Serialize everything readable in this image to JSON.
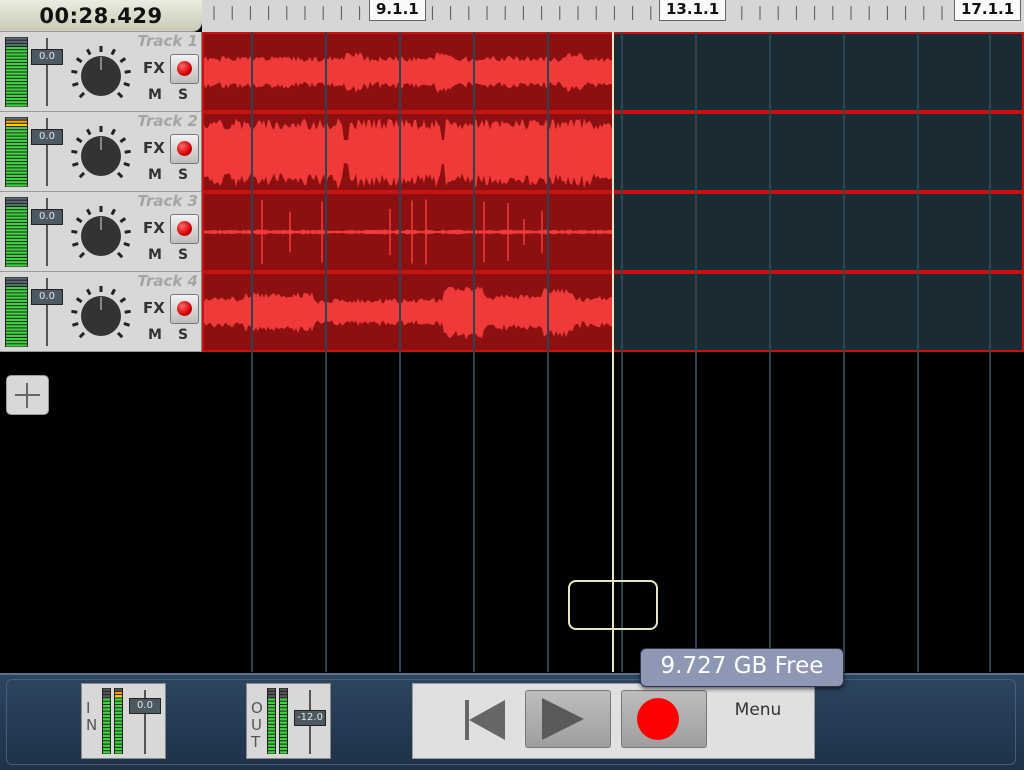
{
  "header": {
    "time": "00:28.429"
  },
  "ruler": {
    "markers": [
      "9.1.1",
      "13.1.1",
      "17.1.1"
    ]
  },
  "tracks": [
    {
      "name": "Track 1",
      "volume": "0.0",
      "fx": "FX",
      "mute": "M",
      "solo": "S"
    },
    {
      "name": "Track 2",
      "volume": "0.0",
      "fx": "FX",
      "mute": "M",
      "solo": "S"
    },
    {
      "name": "Track 3",
      "volume": "0.0",
      "fx": "FX",
      "mute": "M",
      "solo": "S"
    },
    {
      "name": "Track 4",
      "volume": "0.0",
      "fx": "FX",
      "mute": "M",
      "solo": "S"
    }
  ],
  "storage": {
    "free": "9.727 GB Free"
  },
  "input": {
    "letters": "I N",
    "value": "0.0"
  },
  "output": {
    "letters": "O U T",
    "value": "-12.0"
  },
  "transport": {
    "menu_label": "Menu"
  },
  "colors": {
    "region_fill": "#8d1010",
    "waveform": "#f03a3a",
    "lane_bg": "#1b2b33",
    "lane_border": "#cc1111",
    "record_red": "#ff0000",
    "playhead": "#e8e6bf",
    "bar_blue": "#2d4560"
  }
}
